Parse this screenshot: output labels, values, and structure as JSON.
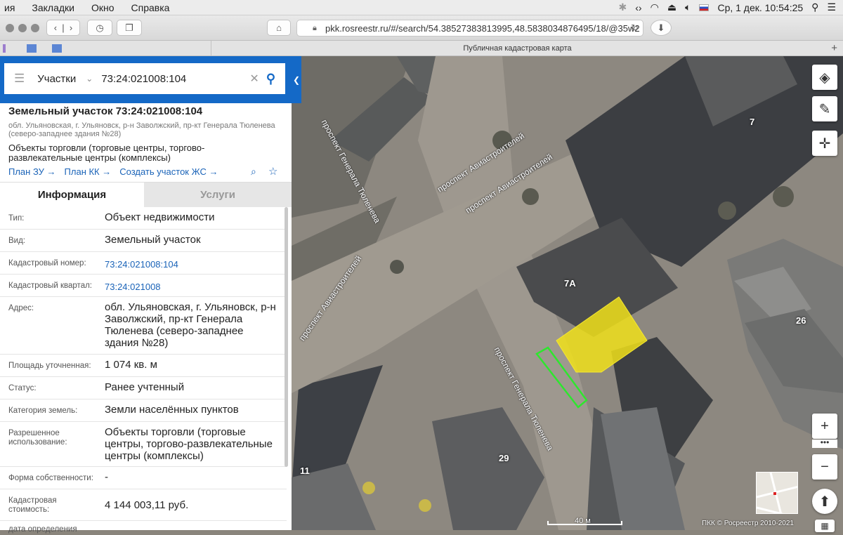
{
  "menubar": {
    "items": [
      "ия",
      "Закладки",
      "Окно",
      "Справка"
    ],
    "clock": "Ср, 1 дек.  10:54:25"
  },
  "browser": {
    "url": "pkk.rosreestr.ru/#/search/54.38527383813995,48.5838034876495/18/@35w2",
    "tab_title": "Публичная кадастровая карта"
  },
  "search": {
    "category": "Участки",
    "query": "73:24:021008:104"
  },
  "card": {
    "title": "Земельный участок 73:24:021008:104",
    "address_short": "обл. Ульяновская, г. Ульяновск, р-н Заволжский, пр-кт Генерала Тюленева (северо-западнее здания №28)",
    "purpose": "Объекты торговли (торговые центры, торгово-развлекательные центры (комплексы)",
    "links": [
      "План ЗУ →",
      "План КК →",
      "Создать участок ЖС →"
    ]
  },
  "tabs": {
    "info": "Информация",
    "services": "Услуги"
  },
  "fields": [
    {
      "label": "Тип:",
      "value": "Объект недвижимости"
    },
    {
      "label": "Вид:",
      "value": "Земельный участок"
    },
    {
      "label": "Кадастровый номер:",
      "value": "73:24:021008:104"
    },
    {
      "label": "Кадастровый квартал:",
      "value": "73:24:021008"
    },
    {
      "label": "Адрес:",
      "value": "обл. Ульяновская, г. Ульяновск, р-н Заволжский, пр-кт Генерала Тюленева (северо-западнее здания №28)"
    },
    {
      "label": "Площадь уточненная:",
      "value": "1 074 кв. м"
    },
    {
      "label": "Статус:",
      "value": "Ранее учтенный"
    },
    {
      "label": "Категория земель:",
      "value": "Земли населённых пунктов"
    },
    {
      "label": "Разрешенное использование:",
      "value": "Объекты торговли (торговые центры, торгово-развлекательные центры (комплексы)"
    },
    {
      "label": "Форма собственности:",
      "value": "-"
    },
    {
      "label": "Кадастровая стоимость:",
      "value": "4 144 003,11 руб."
    },
    {
      "label": "дата определения",
      "value": ""
    }
  ],
  "map": {
    "streets": [
      "проспект Авиастроителей",
      "проспект Авиастроителей",
      "проспект Генерала Тюленева",
      "проспект Авиастроителей",
      "проспект Генерала Тюленева"
    ],
    "buildings": [
      "7",
      "7А",
      "26",
      "29",
      "11"
    ],
    "scale": "40 м",
    "attribution": "ПКК © Росреестр 2010-2021",
    "colors": {
      "parcel_fill": "#f0e11a",
      "highlight": "#2ee62e"
    }
  }
}
